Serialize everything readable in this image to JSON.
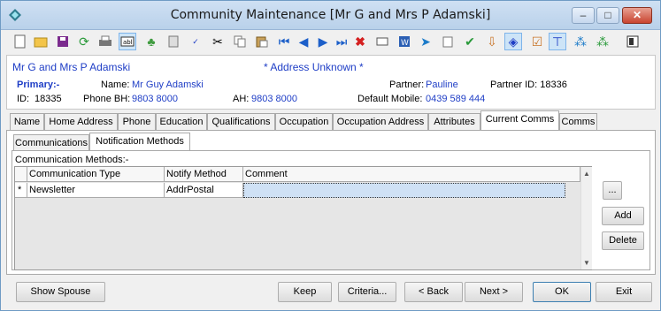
{
  "window": {
    "title": "Community Maintenance  [Mr G and Mrs P Adamski]",
    "controls": {
      "minimize": "–",
      "maximize": "□",
      "close": "✕"
    }
  },
  "toolbar": {
    "icons": [
      "new-icon",
      "open-icon",
      "save-icon",
      "refresh-icon",
      "print-icon",
      "field-icon",
      "tree-icon",
      "calculator-icon",
      "spellcheck-icon",
      "cut-icon",
      "copy-icon",
      "paste-icon",
      "first-record-icon",
      "previous-record-icon",
      "next-record-icon",
      "last-record-icon",
      "delete-icon",
      "card-icon",
      "word-icon",
      "send-icon",
      "clipboard-icon",
      "approve-icon",
      "import-icon",
      "tag-icon",
      "checklist-icon",
      "pin-icon",
      "group-icon",
      "group-alt-icon",
      "exit-icon"
    ],
    "active_index": [
      5,
      23,
      25
    ]
  },
  "header": {
    "name": "Mr G and Mrs P Adamski",
    "status": "* Address Unknown *",
    "primary_label": "Primary:-",
    "name_label": "Name:",
    "name_value": "Mr Guy Adamski",
    "partner_label": "Partner:",
    "partner_value": "Pauline",
    "partner_id": "Partner ID: 18336",
    "id_label": "ID:",
    "id_value": "18335",
    "phone_bh_label": "Phone BH:",
    "phone_bh_value": "9803 8000",
    "ah_label": "AH:",
    "ah_value": "9803 8000",
    "mobile_label": "Default Mobile:",
    "mobile_value": "0439 589 444"
  },
  "tabs": [
    "Name",
    "Home Address",
    "Phone",
    "Education",
    "Qualifications",
    "Occupation",
    "Occupation Address",
    "Attributes",
    "Current Comms",
    "Comms"
  ],
  "selected_tab": "Current Comms",
  "subtabs": [
    "Communications",
    "Notification Methods"
  ],
  "selected_subtab": "Notification Methods",
  "grid": {
    "group_label": "Communication Methods:-",
    "columns": [
      "Communication Type",
      "Notify Method",
      "Comment"
    ],
    "rows": [
      {
        "marker": "*",
        "type": "Newsletter",
        "method": "AddrPostal",
        "comment": ""
      }
    ]
  },
  "side_buttons": {
    "ellipsis": "...",
    "add": "Add",
    "delete": "Delete"
  },
  "bottom_buttons": {
    "show_spouse": "Show Spouse",
    "keep": "Keep",
    "criteria": "Criteria...",
    "back": "< Back",
    "next": "Next >",
    "ok": "OK",
    "exit": "Exit"
  }
}
